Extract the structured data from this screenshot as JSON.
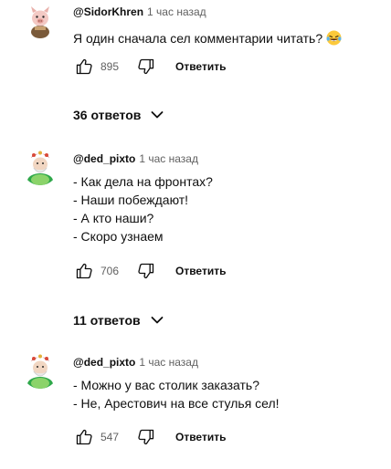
{
  "comments": [
    {
      "author": "@SidorKhren",
      "time": "1 час назад",
      "lines": [
        "Я один сначала сел комментарии читать?"
      ],
      "emoji": "laughing-tears-emoji",
      "likes": "895",
      "reply_label": "Ответить",
      "replies_label": "36 ответов"
    },
    {
      "author": "@ded_pixto",
      "time": "1 час назад",
      "lines": [
        "- Как дела на фронтах?",
        "- Наши побеждают!",
        "- А кто наши?",
        "- Скоро узнаем"
      ],
      "likes": "706",
      "reply_label": "Ответить",
      "replies_label": "11 ответов"
    },
    {
      "author": "@ded_pixto",
      "time": "1 час назад",
      "lines": [
        "- Можно у вас столик заказать?",
        "- Не, Арестович на все стулья сел!"
      ],
      "likes": "547",
      "reply_label": "Ответить"
    }
  ],
  "icons": {
    "like": "thumb-up-icon",
    "dislike": "thumb-down-icon",
    "expand": "chevron-down-icon"
  },
  "colors": {
    "text": "#0f0f0f",
    "secondary": "#606060"
  }
}
